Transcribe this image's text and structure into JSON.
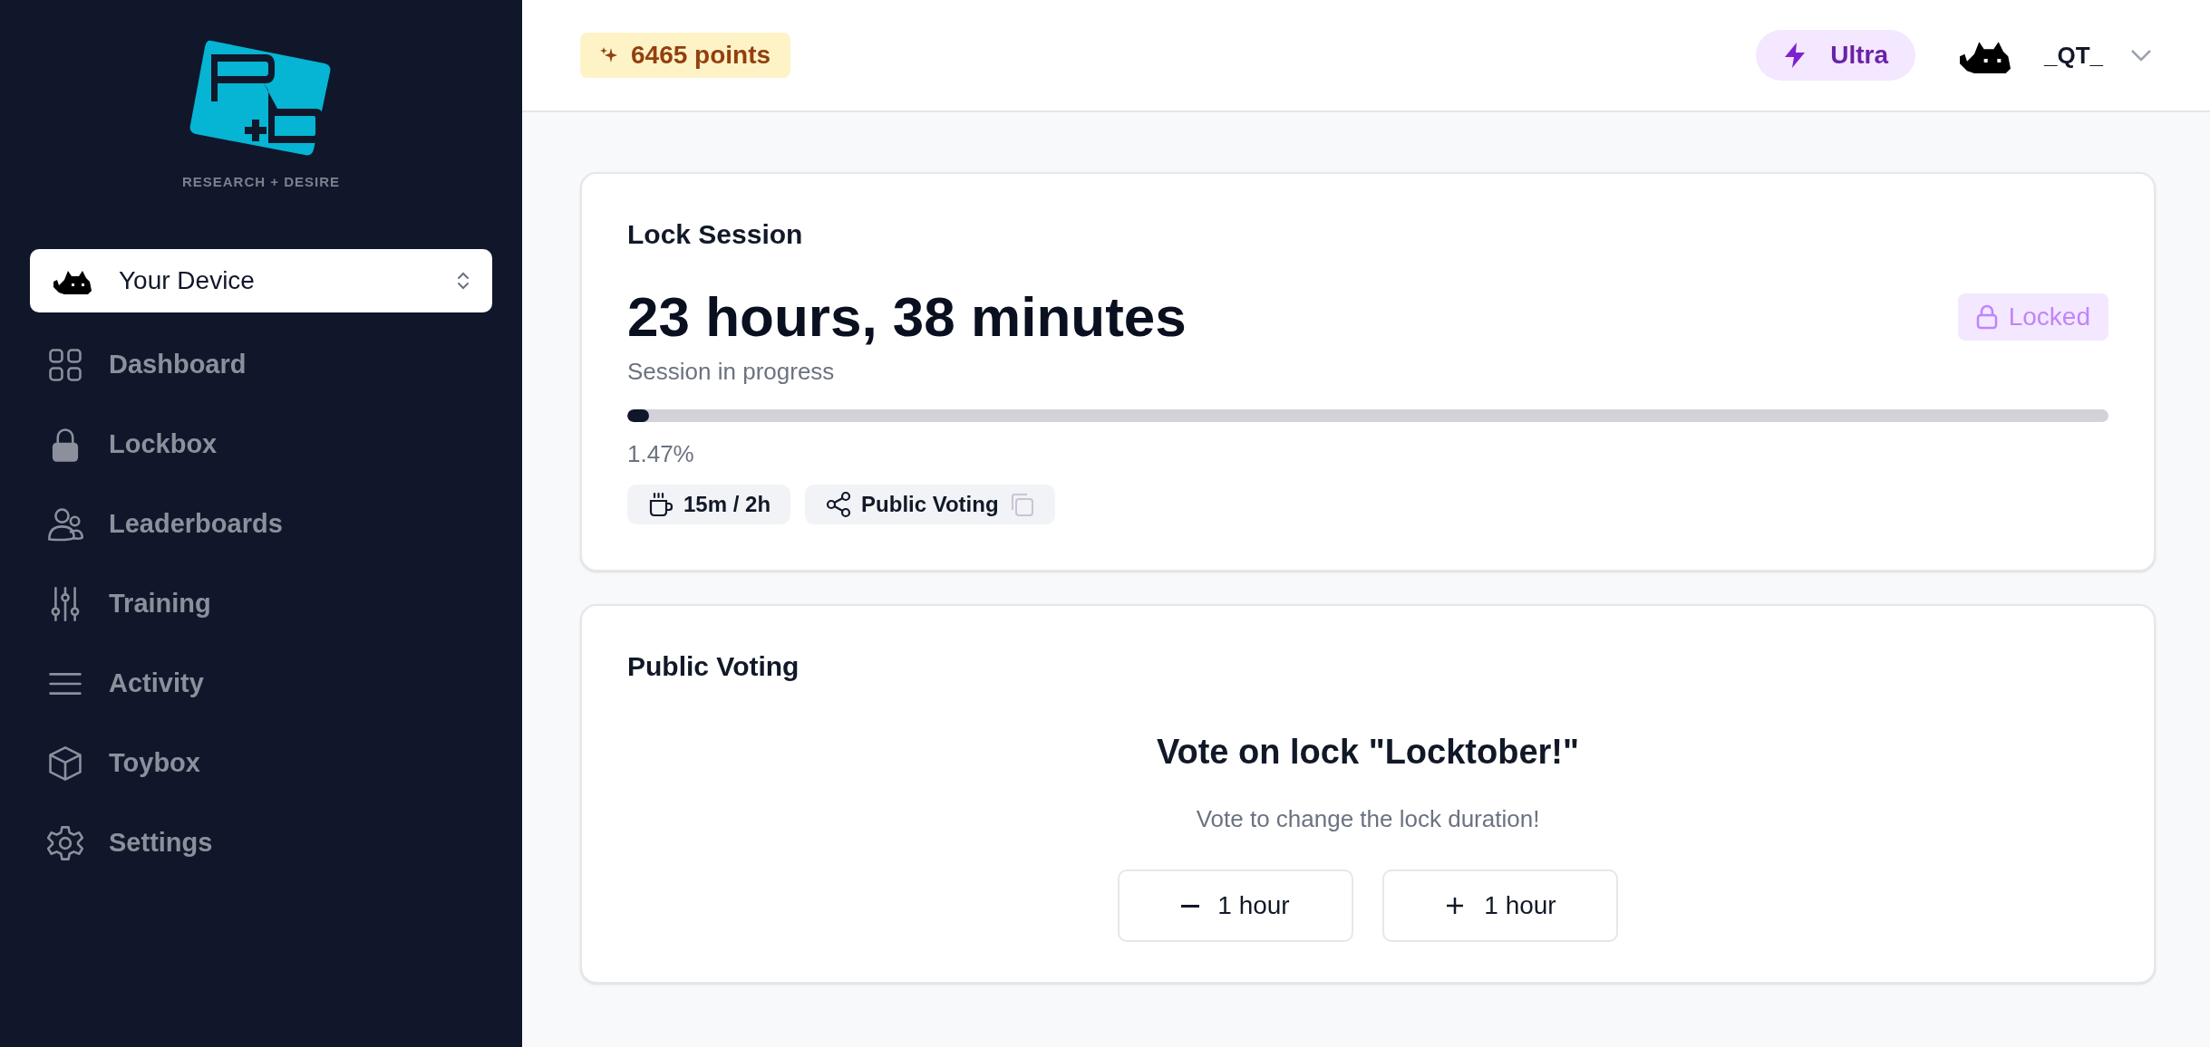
{
  "sidebar": {
    "tagline": "RESEARCH + DESIRE",
    "device_selector": {
      "label": "Your Device"
    },
    "items": [
      {
        "label": "Dashboard"
      },
      {
        "label": "Lockbox"
      },
      {
        "label": "Leaderboards"
      },
      {
        "label": "Training"
      },
      {
        "label": "Activity"
      },
      {
        "label": "Toybox"
      },
      {
        "label": "Settings"
      }
    ]
  },
  "header": {
    "points": "6465 points",
    "plan": "Ultra",
    "user": "_QT_"
  },
  "lock_session": {
    "title": "Lock Session",
    "duration": "23 hours, 38 minutes",
    "badge": "Locked",
    "status": "Session in progress",
    "progress": {
      "level": 0.0147,
      "reading": "1.47%"
    },
    "chips": [
      {
        "label": "15m / 2h"
      },
      {
        "label": "Public Voting"
      }
    ]
  },
  "public_voting": {
    "title": "Public Voting",
    "heading": "Vote on lock \"Locktober!\"",
    "subtitle": "Vote to change the lock duration!",
    "buttons": [
      {
        "label": "1 hour"
      },
      {
        "label": "1 hour"
      }
    ]
  }
}
